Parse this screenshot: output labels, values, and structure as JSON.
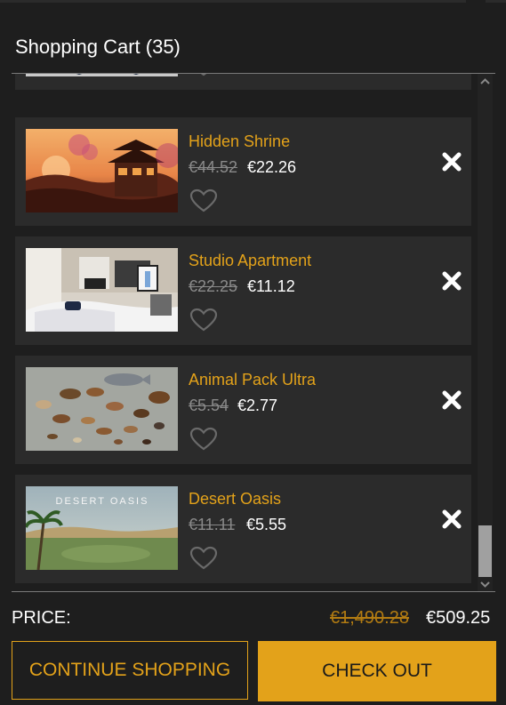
{
  "cart": {
    "title": "Shopping Cart (35)"
  },
  "items": [
    {
      "name": "",
      "old_price": "",
      "new_price": "",
      "favorite_icon": "heart-outline-icon",
      "remove_icon": "close-icon"
    },
    {
      "name": "Hidden Shrine",
      "old_price": "€44.52",
      "new_price": "€22.26",
      "favorite_icon": "heart-outline-icon",
      "remove_icon": "close-icon"
    },
    {
      "name": "Studio Apartment",
      "old_price": "€22.25",
      "new_price": "€11.12",
      "favorite_icon": "heart-outline-icon",
      "remove_icon": "close-icon"
    },
    {
      "name": "Animal Pack Ultra",
      "old_price": "€5.54",
      "new_price": "€2.77",
      "favorite_icon": "heart-outline-icon",
      "remove_icon": "close-icon"
    },
    {
      "name": "Desert Oasis",
      "old_price": "€11.11",
      "new_price": "€5.55",
      "thumbnail_text": "DESERT OASIS",
      "favorite_icon": "heart-outline-icon",
      "remove_icon": "close-icon"
    }
  ],
  "summary": {
    "price_label": "PRICE:",
    "total_old": "€1,490.28",
    "total_new": "€509.25"
  },
  "buttons": {
    "continue_label": "CONTINUE SHOPPING",
    "checkout_label": "CHECK OUT"
  },
  "colors": {
    "accent": "#e3a21a",
    "background": "#1e1e1e",
    "card": "#2b2b2b"
  }
}
